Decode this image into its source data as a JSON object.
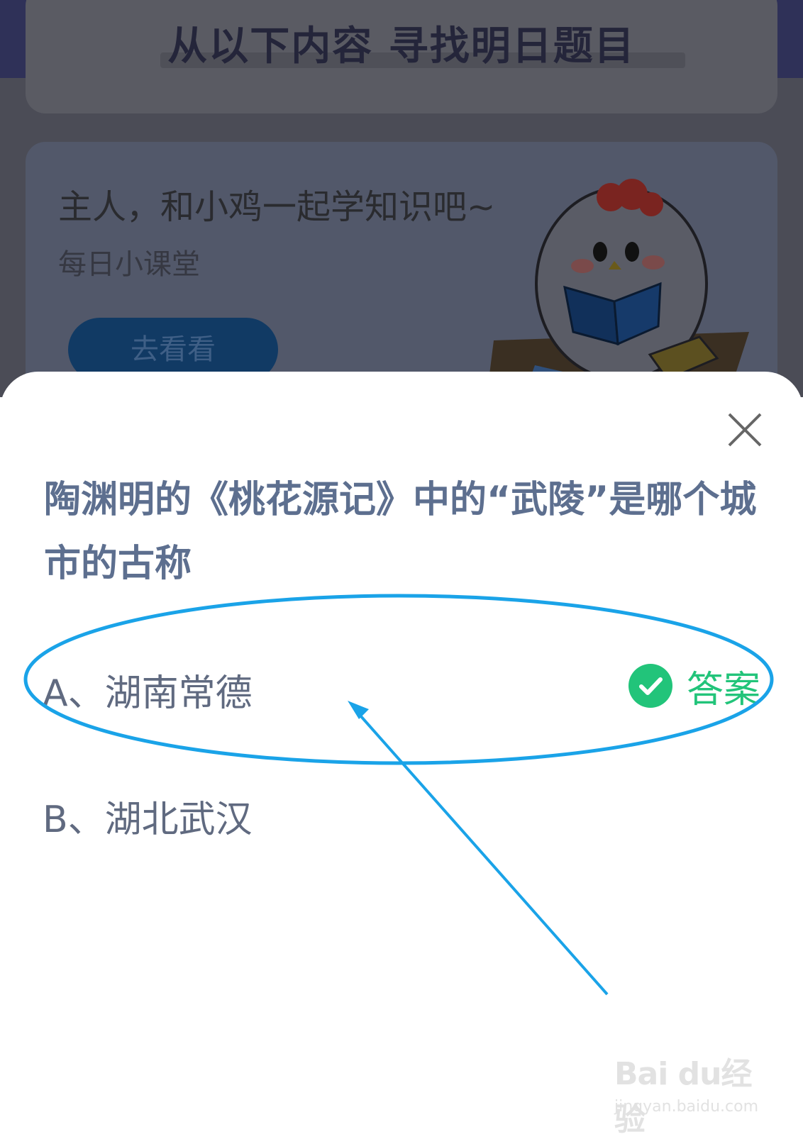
{
  "background": {
    "title": "从以下内容  寻找明日题目",
    "promo": {
      "title": "主人，和小鸡一起学知识吧~",
      "subtitle": "每日小课堂",
      "button_label": "去看看"
    }
  },
  "quiz": {
    "question": "陶渊明的《桃花源记》中的“武陵”是哪个城市的古称",
    "options": [
      {
        "label": "A、湖南常德",
        "correct": true
      },
      {
        "label": "B、湖北武汉",
        "correct": false
      }
    ],
    "answer_label": "答案"
  },
  "watermark": {
    "logo": "Bai du经验",
    "url": "jingyan.baidu.com"
  },
  "colors": {
    "answer_green": "#22c47a",
    "question_text": "#5d6f8f",
    "annotation_blue": "#1aa3e8"
  }
}
